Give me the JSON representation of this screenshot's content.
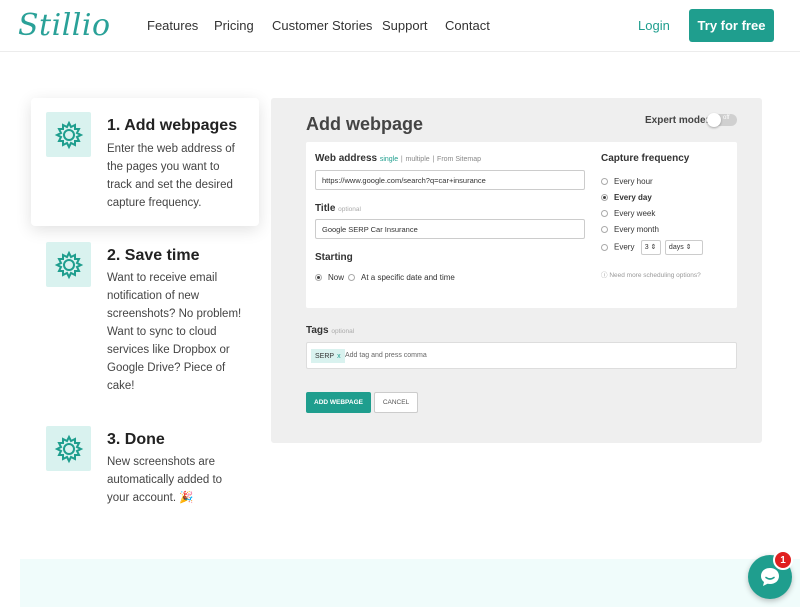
{
  "header": {
    "logo": "Stillio",
    "nav": [
      "Features",
      "Pricing",
      "Customer Stories",
      "Support",
      "Contact"
    ],
    "login": "Login",
    "cta": "Try for free"
  },
  "steps": [
    {
      "title": "1. Add webpages",
      "text": "Enter the web address of the pages you want to track and set the desired capture frequency.",
      "icon": "gear-icon"
    },
    {
      "title": "2. Save time",
      "text": "Want to receive email notification of new screenshots? No problem! Want to sync to cloud services like Dropbox or Google Drive? Piece of cake!",
      "icon": "gear-icon"
    },
    {
      "title": "3. Done",
      "text": "New screenshots are automatically added to your account. 🎉",
      "icon": "gear-icon"
    }
  ],
  "form": {
    "title": "Add webpage",
    "expert_mode_label": "Expert mode:",
    "expert_mode_state": "off",
    "web_address_label": "Web address",
    "mode_single": "single",
    "sep": "|",
    "mode_multiple": "multiple",
    "mode_sitemap": "From Sitemap",
    "url_value": "https://www.google.com/search?q=car+insurance",
    "title_label": "Title",
    "optional": "optional",
    "title_value": "Google SERP Car Insurance",
    "starting_label": "Starting",
    "start_now": "Now",
    "start_specific": "At a specific date and time",
    "capture_label": "Capture frequency",
    "freq_hour": "Every hour",
    "freq_day": "Every day",
    "freq_week": "Every week",
    "freq_month": "Every month",
    "freq_every": "Every",
    "every_count": "3",
    "every_unit": "days",
    "more_options": "Need more scheduling options?",
    "tags_label": "Tags",
    "tag_chip": "SERP",
    "tag_x": "x",
    "tag_placeholder": "Add tag and press comma",
    "add_button": "ADD WEBPAGE",
    "cancel_button": "CANCEL"
  },
  "chat": {
    "badge": "1"
  },
  "colors": {
    "accent": "#1f9e8e",
    "icon_bg": "#d9f2ef",
    "panel_bg": "#efefef"
  }
}
